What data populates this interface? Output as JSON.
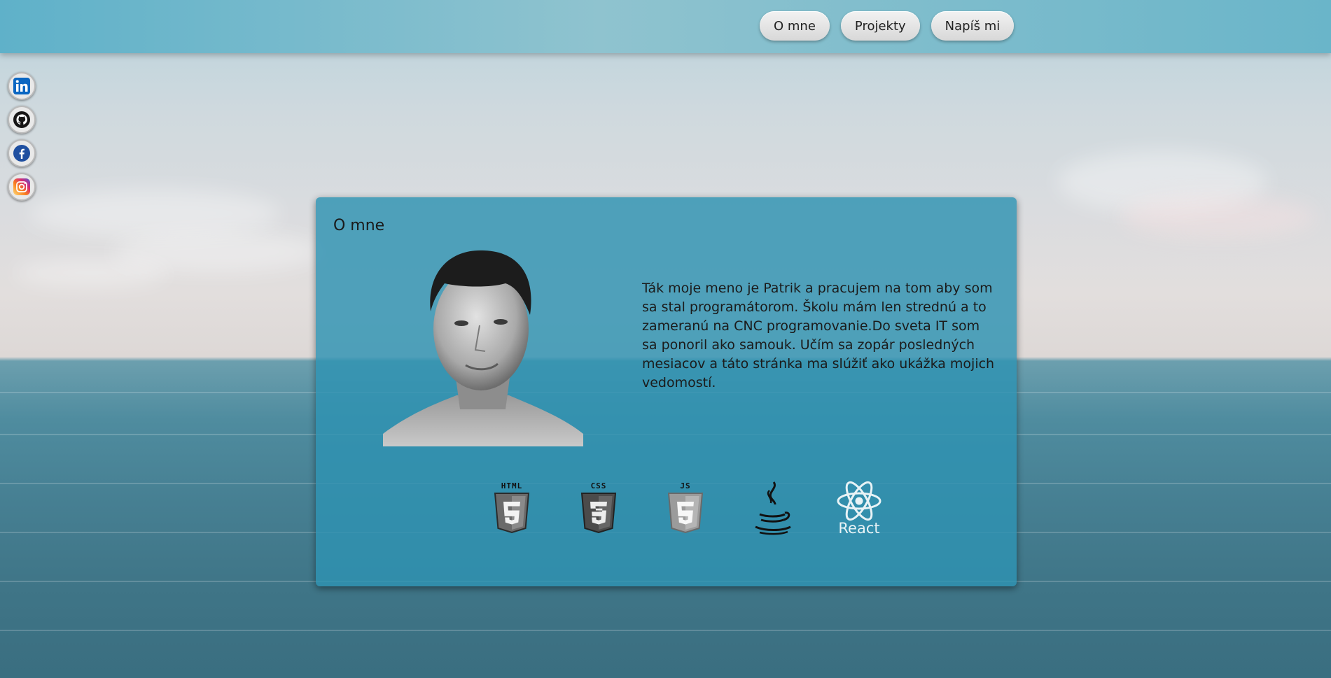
{
  "nav": {
    "items": [
      {
        "label": "O mne"
      },
      {
        "label": "Projekty"
      },
      {
        "label": "Napíš mi"
      }
    ]
  },
  "social": {
    "items": [
      {
        "icon": "linkedin-icon",
        "color": "#0a66c2"
      },
      {
        "icon": "github-icon",
        "color": "#171515"
      },
      {
        "icon": "facebook-icon",
        "color": "#1f4fa0"
      },
      {
        "icon": "instagram-icon",
        "color": "#e1306c"
      }
    ]
  },
  "about": {
    "title": "O mne",
    "bio": "Ták moje meno je Patrik a pracujem na tom aby som sa stal programátorom. Školu mám len strednú a to zameranú na CNC programovanie.Do sveta IT som sa ponoril ako samouk. Učím sa zopár posledných mesiacov a táto stránka ma slúžiť ako ukážka mojich vedomostí.",
    "skills": [
      {
        "icon": "html5-icon",
        "label": "HTML"
      },
      {
        "icon": "css3-icon",
        "label": "CSS"
      },
      {
        "icon": "js-icon",
        "label": "JS"
      },
      {
        "icon": "java-icon",
        "label": ""
      },
      {
        "icon": "react-icon",
        "label": "React"
      }
    ]
  },
  "colors": {
    "card": "#2e92b2",
    "topbar": "#7bbccc",
    "button": "#e6e6e6"
  }
}
